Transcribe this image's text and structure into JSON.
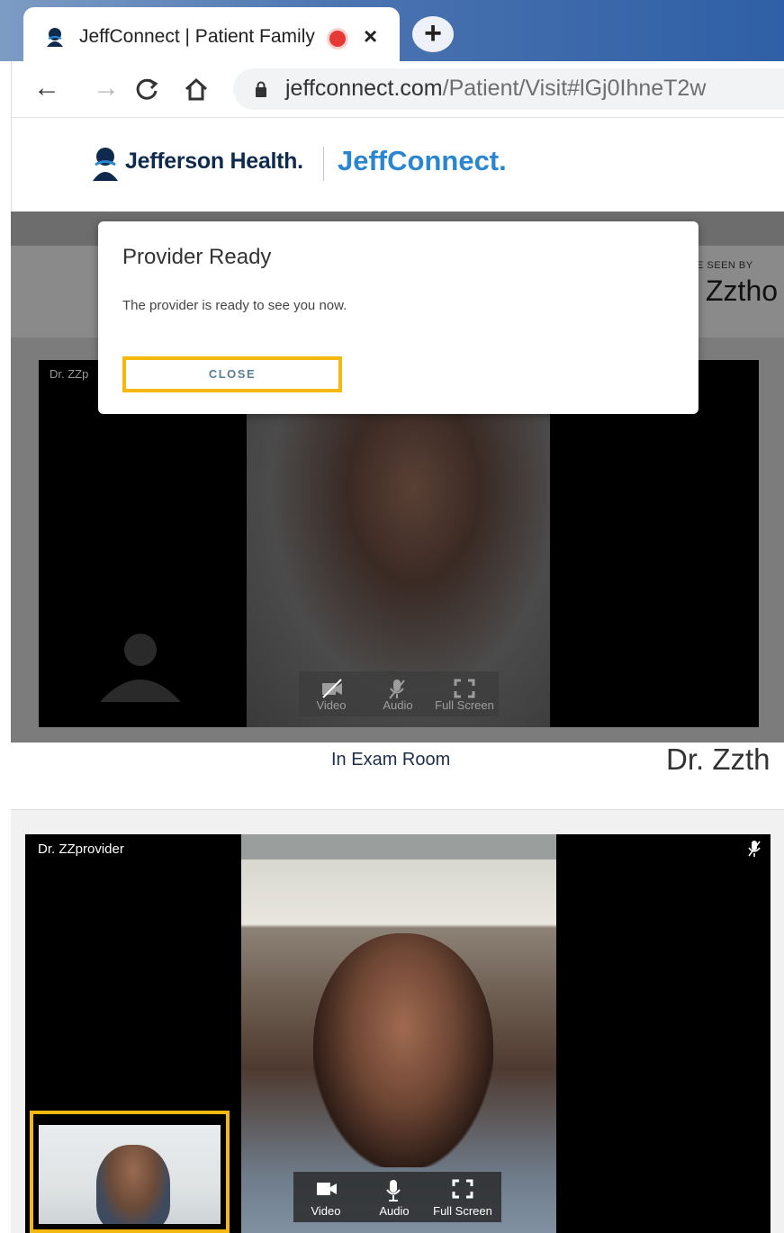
{
  "browser": {
    "tab_title": "JeffConnect | Patient Family",
    "tab_close": "×",
    "new_tab": "+",
    "url_host": "jeffconnect.com",
    "url_path": "/Patient/Visit#lGj0IhneT2w"
  },
  "site": {
    "brand": "Jefferson Health.",
    "product": "JeffConnect."
  },
  "background_panel": {
    "seen_by": "E SEEN BY",
    "provider_name": "Zztho",
    "video_label": "Dr. ZZp"
  },
  "modal": {
    "title": "Provider Ready",
    "message": "The provider is ready to see you now.",
    "close_label": "CLOSE"
  },
  "exam": {
    "status": "In Exam Room",
    "provider_name": "Dr. Zzth"
  },
  "video": {
    "provider_label": "Dr. ZZprovider",
    "controls": {
      "video": "Video",
      "audio": "Audio",
      "full_screen": "Full Screen"
    }
  },
  "colors": {
    "accent_highlight": "#f5b80f",
    "brand_navy": "#0f2a4d",
    "brand_blue": "#2b86d0"
  }
}
